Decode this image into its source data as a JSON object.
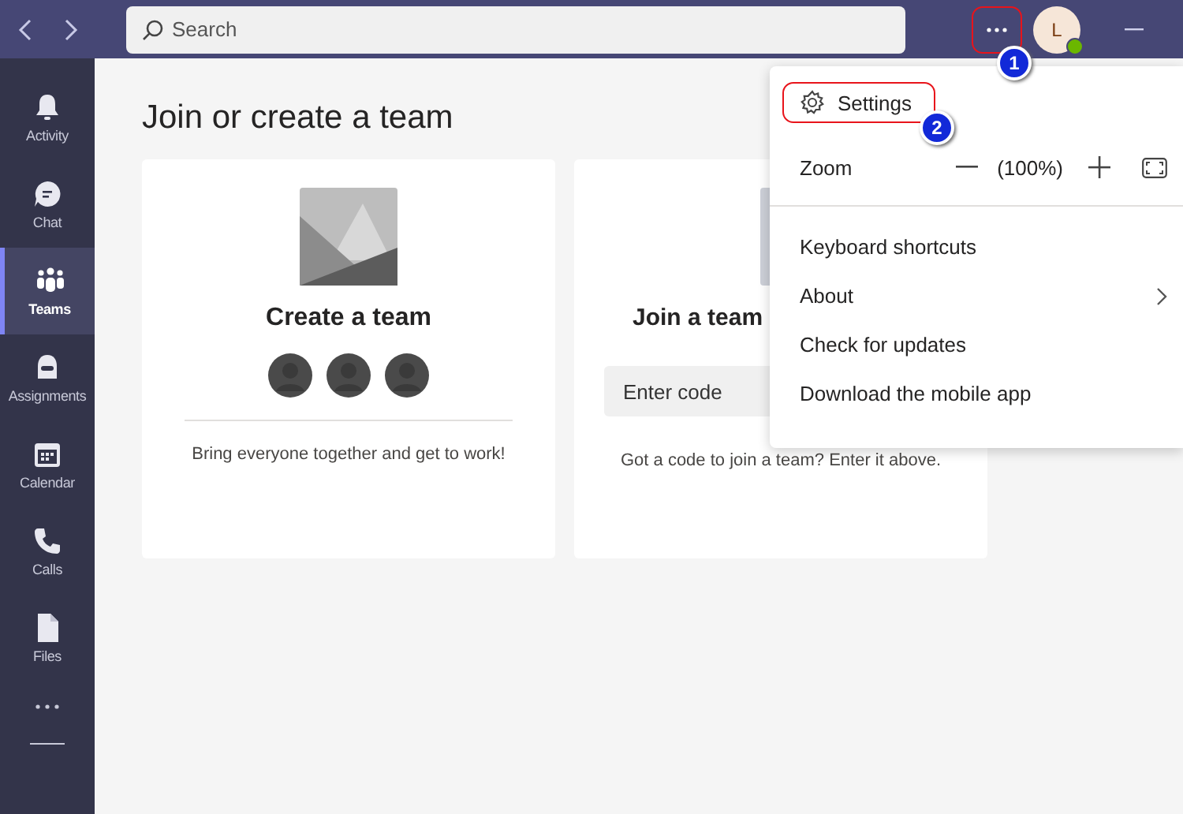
{
  "search": {
    "placeholder": "Search"
  },
  "account": {
    "initial": "L"
  },
  "rail": [
    {
      "label": "Activity",
      "kind": "bell",
      "selected": false
    },
    {
      "label": "Chat",
      "kind": "chat",
      "selected": false
    },
    {
      "label": "Teams",
      "kind": "teams",
      "selected": true
    },
    {
      "label": "Assignments",
      "kind": "bag",
      "selected": false
    },
    {
      "label": "Calendar",
      "kind": "calendar",
      "selected": false
    },
    {
      "label": "Calls",
      "kind": "phone",
      "selected": false
    },
    {
      "label": "Files",
      "kind": "file",
      "selected": false
    }
  ],
  "heading": "Join or create a team",
  "cards": [
    {
      "kind": "create",
      "title": "Create a team",
      "description": "Bring everyone together and get to work!"
    },
    {
      "kind": "join",
      "title": "Join a team",
      "placeholder": "Enter code",
      "description": "Got a code to join a team? Enter it above."
    }
  ],
  "menu": {
    "settings": "Settings",
    "zoom_label": "Zoom",
    "zoom_value": "(100%)",
    "items": [
      {
        "label": "Keyboard shortcuts",
        "submenu": false
      },
      {
        "label": "About",
        "submenu": true
      },
      {
        "label": "Check for updates",
        "submenu": false
      },
      {
        "label": "Download the mobile app",
        "submenu": false
      }
    ]
  },
  "annotations": [
    {
      "number": "1"
    },
    {
      "number": "2"
    }
  ]
}
